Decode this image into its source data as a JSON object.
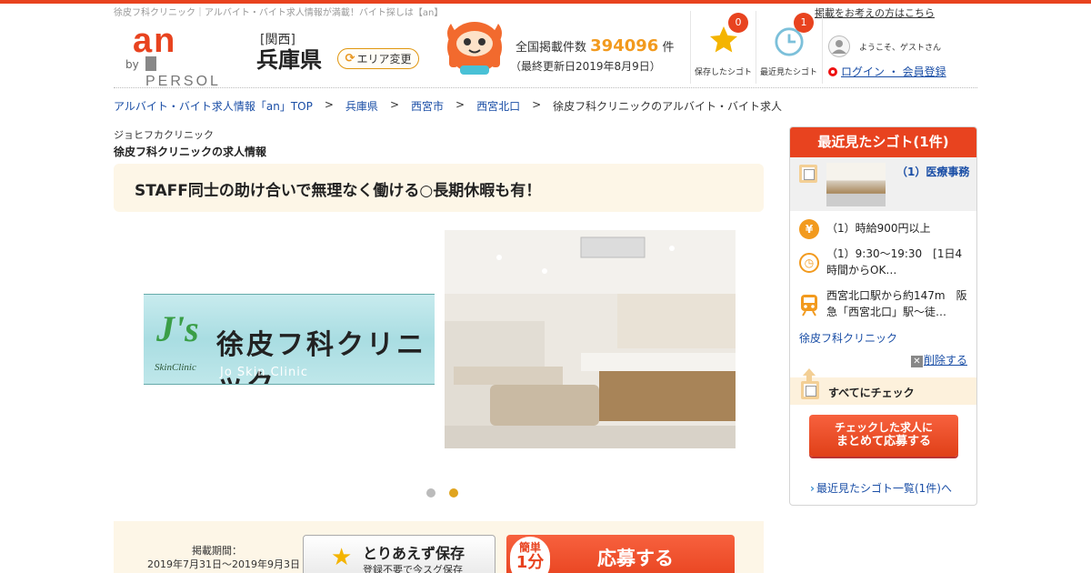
{
  "header": {
    "tagline": "徐皮フ科クリニック｜アルバイト・バイト求人情報が満載！バイト探しは【an】",
    "post_link": "掲載をお考えの方はこちら",
    "logo": {
      "main": "an",
      "by": "by",
      "brand": "PERSOL"
    },
    "region": "[関西]",
    "prefecture": "兵庫県",
    "area_button": "エリア変更",
    "listing_count_label": "全国掲載件数",
    "listing_count": "394096",
    "listing_count_unit": "件",
    "updated": "（最終更新日2019年8月9日）",
    "saved": {
      "label": "保存したシゴト",
      "count": "0"
    },
    "recent": {
      "label": "最近見たシゴト",
      "count": "1"
    },
    "welcome": "ようこそ、ゲストさん",
    "login": "ログイン ・ 会員登録"
  },
  "breadcrumb": [
    {
      "label": "アルバイト・バイト求人情報「an」TOP",
      "link": true
    },
    {
      "label": "兵庫県",
      "link": true
    },
    {
      "label": "西宮市",
      "link": true
    },
    {
      "label": "西宮北口",
      "link": true
    },
    {
      "label": "徐皮フ科クリニックのアルバイト・バイト求人",
      "link": false
    }
  ],
  "breadcrumb_sep": ">",
  "job": {
    "company_kana": "ジョヒフカクリニック",
    "heading": "徐皮フ科クリニックの求人情報",
    "catch_copy": "STAFF同士の助け合いで無理なく働ける○長期休暇も有！",
    "slide_logo": {
      "mark": "J's",
      "mark_sub": "SkinClinic",
      "name_jp": "徐皮フ科クリニック",
      "name_en": "Jo Skin Clinic"
    },
    "slides_total": 2,
    "slide_active": 2
  },
  "apply": {
    "period_label": "掲載期間：",
    "period": "2019年7月31日～2019年9月3日",
    "save_main": "とりあえず保存",
    "save_sub": "登録不要で今スグ保存",
    "quick_a": "簡単",
    "quick_b": "1分",
    "apply_label": "応募する"
  },
  "sidebar": {
    "title": "最近見たシゴト(1件)",
    "item_title": "（1）医療事務",
    "wage": "（1）時給900円以上",
    "hours": "（1）9:30～19:30　[1日4時間からOK…",
    "access": "西宮北口駅から約147m　阪急「西宮北口」駅～徒…",
    "company": "徐皮フ科クリニック",
    "delete": "削除する",
    "check_all": "すべてにチェック",
    "bulk_line1": "チェックした求人に",
    "bulk_line2": "まとめて応募する",
    "recent_link": "最近見たシゴト一覧(1件)へ",
    "icons": {
      "wage": "yen-icon",
      "hours": "clock-icon",
      "access": "train-icon"
    }
  },
  "colors": {
    "brand": "#e8431f",
    "accent": "#f29a1e",
    "link": "#1a4ea6",
    "cream": "#fdf6e7"
  }
}
